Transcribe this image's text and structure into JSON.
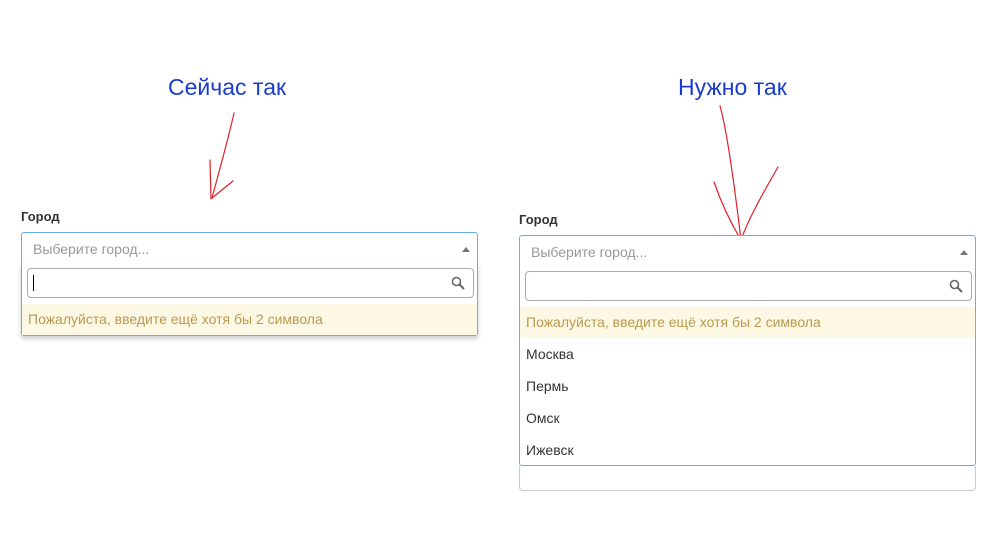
{
  "annotations": {
    "current": "Сейчас так",
    "needed": "Нужно так"
  },
  "field_label": "Город",
  "select_placeholder": "Выберите город...",
  "search_value": "",
  "hint_text": "Пожалуйста, введите ещё хотя бы 2 символа",
  "options": [
    "Москва",
    "Пермь",
    "Омск",
    "Ижевск"
  ],
  "colors": {
    "annotation": "#1a3cc8",
    "arrow": "#e0202a",
    "focus_border": "#66afe9",
    "hint_bg": "#fcf8e3",
    "hint_text": "#b89a50"
  },
  "icons": {
    "search": "magnifier-icon",
    "caret": "caret-up-icon"
  }
}
